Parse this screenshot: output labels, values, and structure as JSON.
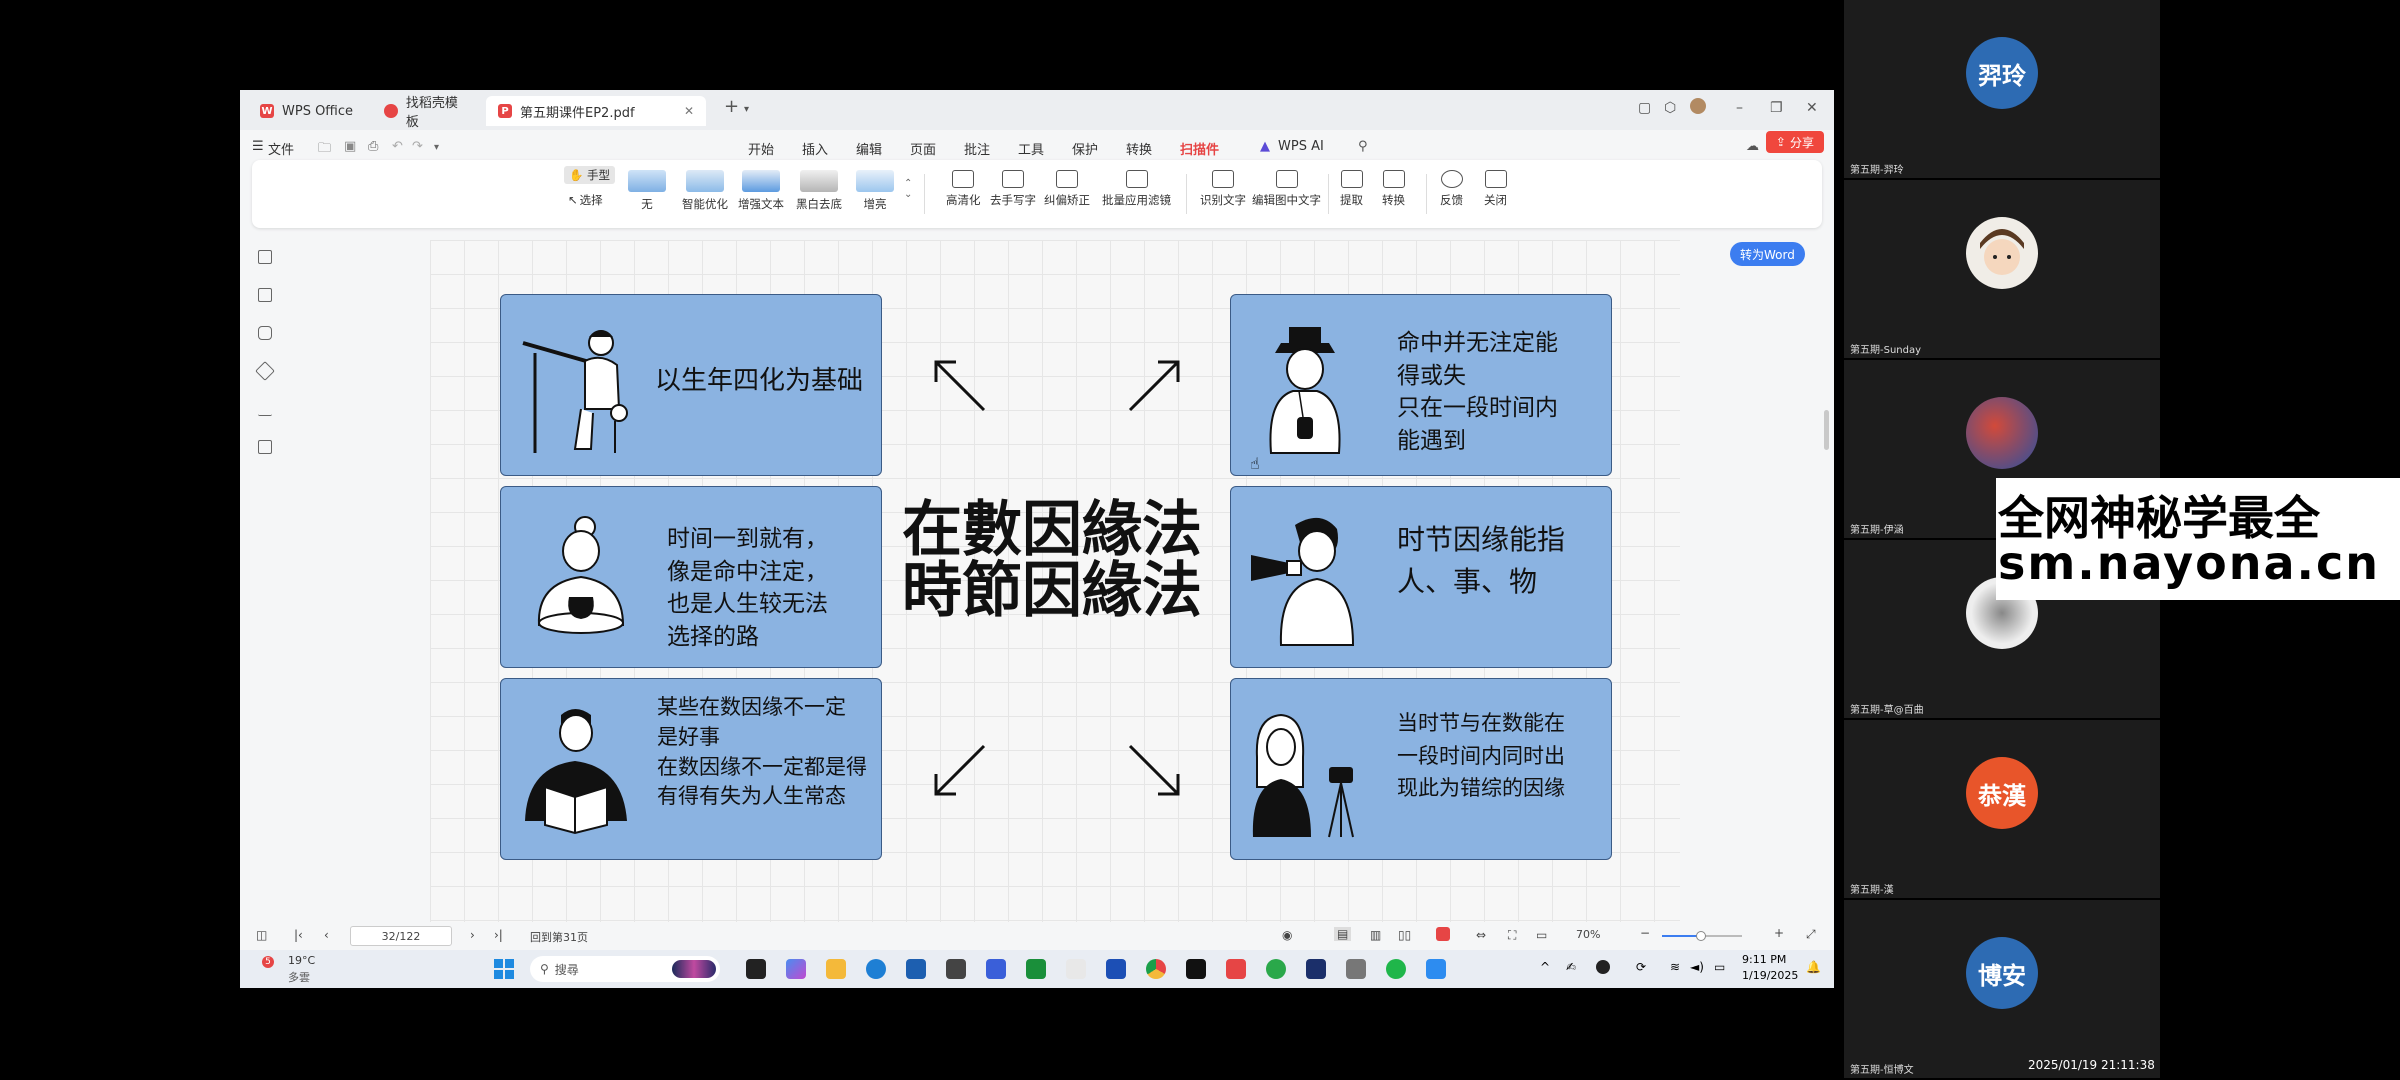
{
  "window": {
    "tabs": [
      {
        "label": "WPS Office",
        "icon": "wps-logo-icon"
      },
      {
        "label": "找稻壳模板",
        "icon": "docer-icon"
      },
      {
        "label": "第五期课件EP2.pdf",
        "icon": "pdf-icon"
      }
    ],
    "share_label": "分享",
    "file_menu": "文件",
    "menus": [
      "开始",
      "插入",
      "编辑",
      "页面",
      "批注",
      "工具",
      "保护",
      "转换",
      "扫描件",
      "WPS AI"
    ],
    "active_menu": "扫描件",
    "ribbon": {
      "hand": "手型",
      "select": "选择",
      "filters": [
        "无",
        "智能优化",
        "增强文本",
        "黑白去底",
        "增亮"
      ],
      "tools": [
        "高清化",
        "去手写字",
        "纠偏矫正",
        "批量应用滤镜",
        "识别文字",
        "编辑图中文字",
        "提取",
        "转换",
        "反馈",
        "关闭"
      ]
    },
    "to_word": "转为Word"
  },
  "slide": {
    "title_line1": "在數因緣法",
    "title_line2": "時節因緣法",
    "cards": [
      {
        "lines": [
          "以生年四化为基础"
        ],
        "figure": "architect-drawing-figure"
      },
      {
        "lines": [
          "命中并无注定能",
          "得或失",
          "只在一段时间内",
          "能遇到"
        ],
        "figure": "man-with-camera-figure"
      },
      {
        "lines": [
          "时间一到就有，",
          "像是命中注定，",
          "也是人生较无法",
          "选择的路"
        ],
        "figure": "potter-figure"
      },
      {
        "lines": [
          "时节因缘能指",
          "人、事、物"
        ],
        "figure": "megaphone-figure"
      },
      {
        "lines": [
          "某些在数因缘不一定",
          "是好事",
          "在数因缘不一定都是得",
          "有得有失为人生常态"
        ],
        "figure": "reader-figure"
      },
      {
        "lines": [
          "当时节与在数能在",
          "一段时间内同时出",
          "现此为错综的因缘"
        ],
        "figure": "woman-with-tripod-figure"
      }
    ]
  },
  "status": {
    "page": "32/122",
    "back_label": "回到第31页",
    "zoom": "70%"
  },
  "taskbar": {
    "weather_temp": "19°C",
    "weather_text": "多雲",
    "weather_badge": "5",
    "search_placeholder": "搜尋",
    "time": "9:11 PM",
    "date": "1/19/2025"
  },
  "participants": [
    {
      "avatar_text": "羿玲",
      "color": "#2d6bb3",
      "name": "第五期-羿玲"
    },
    {
      "avatar_text": "",
      "color": "#f0ede7",
      "name": "第五期-Sunday"
    },
    {
      "avatar_text": "",
      "color": "#c04a3a",
      "name": "第五期-伊涵"
    },
    {
      "avatar_text": "",
      "color": "#e8e8ea",
      "name": "第五期-草@百曲"
    },
    {
      "avatar_text": "恭漢",
      "color": "#e8552a",
      "name": "第五期-漢"
    },
    {
      "avatar_text": "博安",
      "color": "#2d6bb3",
      "name": "第五期-恒博文"
    }
  ],
  "timestamp": "2025/01/19 21:11:38",
  "watermark": {
    "line1": "全网神秘学最全",
    "line2": "sm.nayona.cn"
  }
}
